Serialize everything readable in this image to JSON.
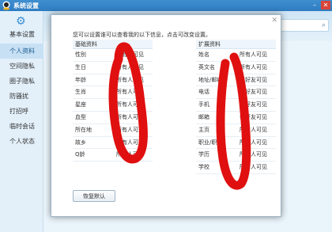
{
  "window": {
    "title": "系统设置"
  },
  "sidebar": {
    "category": "基本设置",
    "items": [
      {
        "label": "个人资料",
        "active": true
      },
      {
        "label": "空间隐私",
        "active": false
      },
      {
        "label": "圈子隐私",
        "active": false
      },
      {
        "label": "防骚扰",
        "active": false
      },
      {
        "label": "打招呼",
        "active": false
      },
      {
        "label": "临时会话",
        "active": false
      },
      {
        "label": "个人状态",
        "active": false
      }
    ]
  },
  "dialog": {
    "intro": "您可以设置谁可以查看我的以下信息，点击可改变设置。",
    "basic": {
      "header": "基础资料",
      "rows": [
        {
          "field": "性别",
          "value": "所有人可见"
        },
        {
          "field": "生日",
          "value": "所有人可见"
        },
        {
          "field": "年龄",
          "value": "所有人可见"
        },
        {
          "field": "生肖",
          "value": "所有人可见"
        },
        {
          "field": "星座",
          "value": "所有人可见"
        },
        {
          "field": "血型",
          "value": "所有人可见"
        },
        {
          "field": "所在地",
          "value": "所有人可见"
        },
        {
          "field": "故乡",
          "value": "所有人可见"
        },
        {
          "field": "Q龄",
          "value": "所有人可见"
        }
      ]
    },
    "extended": {
      "header": "扩展资料",
      "rows": [
        {
          "field": "姓名",
          "value": "所有人可见"
        },
        {
          "field": "英文名",
          "value": "所有人可见"
        },
        {
          "field": "地址/邮编",
          "value": "仅好友可见"
        },
        {
          "field": "电话",
          "value": "仅好友可见"
        },
        {
          "field": "手机",
          "value": "仅好友可见"
        },
        {
          "field": "邮箱",
          "value": "仅好友可见"
        },
        {
          "field": "主页",
          "value": "所有人可见"
        },
        {
          "field": "职业/职位",
          "value": "所有人可见"
        },
        {
          "field": "学历",
          "value": "所有人可见"
        },
        {
          "field": "学校",
          "value": "所有人可见"
        }
      ]
    },
    "reset_label": "恢复默认"
  },
  "colors": {
    "scribble": "#e01010",
    "accent": "#2f7cc1"
  }
}
